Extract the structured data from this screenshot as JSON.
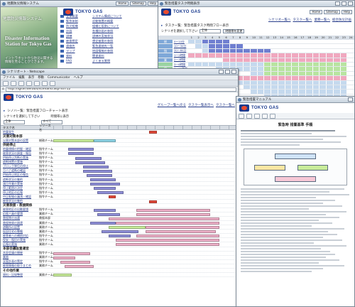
{
  "window_a": {
    "title": "地震防災情報システム",
    "brand": "TOKYO GAS",
    "hero_title": "地震防災情報システム",
    "hero_subtitle": "Disaster Information Station for Tokyo Gas",
    "hero_note": "イントラネットから防災に関する 情報を見ることができます。",
    "top_buttons": [
      "Home",
      "Sitemap",
      "Help"
    ],
    "links": [
      {
        "a": "全体概要",
        "b": "システム構成について"
      },
      {
        "a": "緊急体制",
        "b": "初動措置の概要"
      },
      {
        "a": "防災組織",
        "b": "組織と役割について"
      },
      {
        "a": "計画",
        "b": "各種計画の参照"
      },
      {
        "a": "訓練",
        "b": "訓練の実施状況"
      },
      {
        "a": "被害想定",
        "b": "想定被害の参照"
      },
      {
        "a": "連絡先",
        "b": "緊急連絡先一覧"
      },
      {
        "a": "マップ",
        "b": "地図情報の参照"
      },
      {
        "a": "資料",
        "b": "関連資料"
      },
      {
        "a": "FAQ",
        "b": "よくある質問"
      }
    ]
  },
  "window_b": {
    "title": "シナリオート - Netscape",
    "menu": [
      "ファイル",
      "編集",
      "表示",
      "移動",
      "Communicator",
      "ヘルプ"
    ],
    "address": "http://tgsvr/default/scenario.asp?id=12",
    "brand": "TOKYO GAS",
    "breadcrumbs": [
      "グループ一覧へ戻る",
      "タスク一覧表示へ",
      "タスク一覧へ"
    ],
    "page_title": "シノハー覧：緊急措置フローチャート表示",
    "form_label": "シナリオを選択して下さい",
    "form_value": "全体",
    "filter_label": "時間帯に表示",
    "filter_value": "すべて",
    "col_task": "タスク名",
    "col_resource": "リソース名",
    "col_time": "時間経過",
    "rows": [
      {
        "name": "地震発生",
        "team": "",
        "bars": [
          [
            0.52,
            0.04,
            "#e04a3a"
          ]
        ]
      },
      {
        "section": "災害対策本部"
      },
      {
        "name": "災害対策本部の設置",
        "team": "総務チーム",
        "bars": [
          [
            0.0,
            0.22,
            "#c8ec9a"
          ],
          [
            0.22,
            0.12,
            "#8ed4e6"
          ]
        ]
      },
      {
        "section": "供給停止"
      },
      {
        "name": "地震規模の把握・確認",
        "team": "指令チーム",
        "bars": [
          [
            0.08,
            0.14,
            "#8f8fd8"
          ]
        ]
      },
      {
        "name": "被害状況の調査・報告",
        "team": "指令チーム",
        "bars": [
          [
            0.08,
            0.14,
            "#8f8fd8"
          ]
        ]
      },
      {
        "name": "供給停止判断の実施",
        "team": "指令チーム",
        "bars": [
          [
            0.12,
            0.14,
            "#8f8fd8"
          ]
        ]
      },
      {
        "name": "遮断措置の実施",
        "team": "指令チーム",
        "bars": [
          [
            0.12,
            0.16,
            "#8f8fd8"
          ]
        ]
      },
      {
        "name": "ブロック単位の停止",
        "team": "指令チーム",
        "bars": [
          [
            0.16,
            0.14,
            "#8f8fd8"
          ]
        ]
      },
      {
        "name": "ガバナ遮断の確認",
        "team": "指令チーム",
        "bars": [
          [
            0.16,
            0.16,
            "#8f8fd8"
          ]
        ]
      },
      {
        "name": "供給停止地区の報告",
        "team": "指令チーム",
        "bars": [
          [
            0.18,
            0.14,
            "#8f8fd8"
          ]
        ]
      },
      {
        "name": "遮断状況の集約",
        "team": "指令チーム",
        "bars": [
          [
            0.2,
            0.14,
            "#8f8fd8"
          ]
        ]
      },
      {
        "name": "減圧作業の実施",
        "team": "指令チーム",
        "bars": [
          [
            0.2,
            0.16,
            "#8f8fd8"
          ]
        ]
      },
      {
        "name": "停止範囲の決定",
        "team": "指令チーム",
        "bars": [
          [
            0.22,
            0.12,
            "#8f8fd8"
          ]
        ]
      },
      {
        "name": "停止地区の広報",
        "team": "指令チーム",
        "bars": [
          [
            0.24,
            0.14,
            "#8f8fd8"
          ]
        ]
      },
      {
        "name": "中圧幹線の漏洩・確認",
        "team": "指令チーム",
        "bars": [
          [
            0.3,
            0.04,
            "#e04a3a"
          ]
        ]
      },
      {
        "name": "被害状況の集約",
        "team": "",
        "bars": [
          [
            0.52,
            0.04,
            "#e04a3a"
          ]
        ]
      },
      {
        "section": "災害救援・救援関係"
      },
      {
        "name": "被害地区の出動要請",
        "team": "指令チーム",
        "bars": [
          [
            0.22,
            0.12,
            "#8f8fd8"
          ],
          [
            0.45,
            0.4,
            "#eeb0c8"
          ]
        ]
      },
      {
        "name": "応援人員の要請",
        "team": "業務チーム",
        "bars": [
          [
            0.24,
            0.12,
            "#8f8fd8"
          ],
          [
            0.45,
            0.4,
            "#eeb0c8"
          ]
        ]
      },
      {
        "name": "救援隊の派遣",
        "team": "救援本部",
        "bars": [
          [
            0.3,
            0.6,
            "#eeb0c8"
          ]
        ]
      },
      {
        "name": "救援物資の調達",
        "team": "業務チーム",
        "bars": [
          [
            0.2,
            0.14,
            "#8f8fd8"
          ],
          [
            0.34,
            0.56,
            "#eeb0c8"
          ]
        ]
      },
      {
        "name": "避難所の設置",
        "team": "業務チーム",
        "bars": [
          [
            0.3,
            0.2,
            "#c8ec9a"
          ],
          [
            0.5,
            0.4,
            "#eeb0c8"
          ]
        ]
      },
      {
        "name": "仮設住宅の整備",
        "team": "業務チーム",
        "bars": [
          [
            0.26,
            0.2,
            "#8f8fd8"
          ],
          [
            0.5,
            0.38,
            "#eeb0c8"
          ]
        ]
      },
      {
        "name": "被害者への補償対応",
        "team": "指令チーム",
        "bars": [
          [
            0.3,
            0.12,
            "#8f8fd8"
          ],
          [
            0.45,
            0.45,
            "#eeb0c8"
          ]
        ]
      },
      {
        "name": "保安・復旧の実施",
        "team": "指令チーム",
        "bars": [
          [
            0.34,
            0.56,
            "#eeb0c8"
          ]
        ]
      },
      {
        "name": "広報の実施",
        "team": "業務チーム",
        "bars": [
          [
            0.34,
            0.56,
            "#eeb0c8"
          ]
        ]
      },
      {
        "section": "本部会議設置運営"
      },
      {
        "name": "本部会議の開催",
        "team": "指令チーム",
        "bars": [
          [
            0.0,
            0.2,
            "#eeb0c8"
          ]
        ]
      },
      {
        "name": "業務",
        "team": "業務チーム",
        "bars": [
          [
            0.0,
            0.12,
            "#eeb0c8"
          ]
        ]
      },
      {
        "name": "支援計画の策定",
        "team": "指令チーム",
        "bars": [
          [
            0.04,
            0.16,
            "#eeb0c8"
          ]
        ]
      },
      {
        "name": "被害情報の取りまとめ",
        "team": "業務チーム",
        "bars": [
          [
            0.06,
            0.16,
            "#eeb0c8"
          ]
        ]
      },
      {
        "section": "その他作業"
      },
      {
        "name": "資料・記録整理",
        "team": "業務チーム",
        "bars": [
          [
            0.0,
            0.1,
            "#c8ec9a"
          ]
        ]
      }
    ]
  },
  "window_c": {
    "title": "緊急措置タスク時間表示",
    "brand": "TOKYO GAS",
    "top_buttons": [
      "Home",
      "Sitemap",
      "Help"
    ],
    "links": [
      "シナリオ一覧へ",
      "タスク一覧へ",
      "業務一覧へ",
      "総合防災計画"
    ],
    "page_title": "タスク一覧：緊急措置タスク時間フロー表示",
    "form_label": "シナリオを選択して下さい",
    "form_value": "全体",
    "button_label": "時間帯を変更",
    "hours": [
      "1",
      "2",
      "3",
      "4",
      "5",
      "6",
      "7",
      "8",
      "9",
      "10",
      "11",
      "12",
      "13",
      "14",
      "15",
      "16",
      "17",
      "18",
      "19",
      "20",
      "21",
      "22",
      "23",
      "24"
    ],
    "groups": [
      "総",
      "指",
      "業",
      "保",
      "救",
      "供",
      "本",
      "資"
    ],
    "rows": [
      {
        "label": "0～10分",
        "color": "#7fa8d8",
        "cells": "11333300000000000000000000"
      },
      {
        "label": "10～30分",
        "color": "#7fa8d8",
        "cells": "01133333000000000000000000"
      },
      {
        "label": "30～60分",
        "color": "#7fa8d8",
        "cells": "00133333333300000000000000"
      },
      {
        "label": "1～2時間",
        "color": "#7fa8d8",
        "cells": "22222222222222222222222000"
      },
      {
        "label": "2～3時間",
        "color": "#7fa8d8",
        "cells": "00000222222222222222222000"
      },
      {
        "label": "3～6時間",
        "color": "#9ad3a1",
        "cells": "11111111111444444444444000"
      },
      {
        "label": "6～12時間",
        "color": "#9ad3a1",
        "cells": "00001111111444444444444000"
      },
      {
        "label": "12～24時間",
        "color": "#9ad3a1",
        "cells": "00000000011444444444444000"
      },
      {
        "label": "1～2日",
        "color": "#9ad3a1",
        "cells": "00002222222222222222222000"
      },
      {
        "label": "2～3日",
        "color": "#9ad3a1",
        "cells": "00000011111111111111111000"
      },
      {
        "label": "3～7日",
        "color": "#9ad3a1",
        "cells": "00000000111111111111111000"
      },
      {
        "label": "1～2週",
        "color": "#9ad3a1",
        "cells": "00000000011111111111111000"
      },
      {
        "label": "2～4週",
        "color": "#9ad3a1",
        "cells": "00000000000111111111111000"
      },
      {
        "label": "1～2月",
        "color": "#9ad3a1",
        "cells": "00000000000011111111111000"
      },
      {
        "label": "2～3月",
        "color": "#9ad3a1",
        "cells": "00000000000001111111111000"
      },
      {
        "label": "3月以降",
        "color": "#9ad3a1",
        "cells": "00000000000000111111111000"
      }
    ]
  },
  "window_d": {
    "title": "緊急措置マニュアル",
    "brand": "TOKYO GAS",
    "heading": "緊急時 措置基準 手順",
    "toolbar_icons": [
      "back-icon",
      "forward-icon",
      "reload-icon",
      "print-icon",
      "search-icon"
    ]
  },
  "colors": {
    "blue_header": "#2b4f9e",
    "brand_blue": "#1a3b8f",
    "brand_red": "#e94b2f",
    "purple_bar": "#8f8fd8",
    "pink_bar": "#eeb0c8",
    "green_bar": "#c8ec9a"
  }
}
